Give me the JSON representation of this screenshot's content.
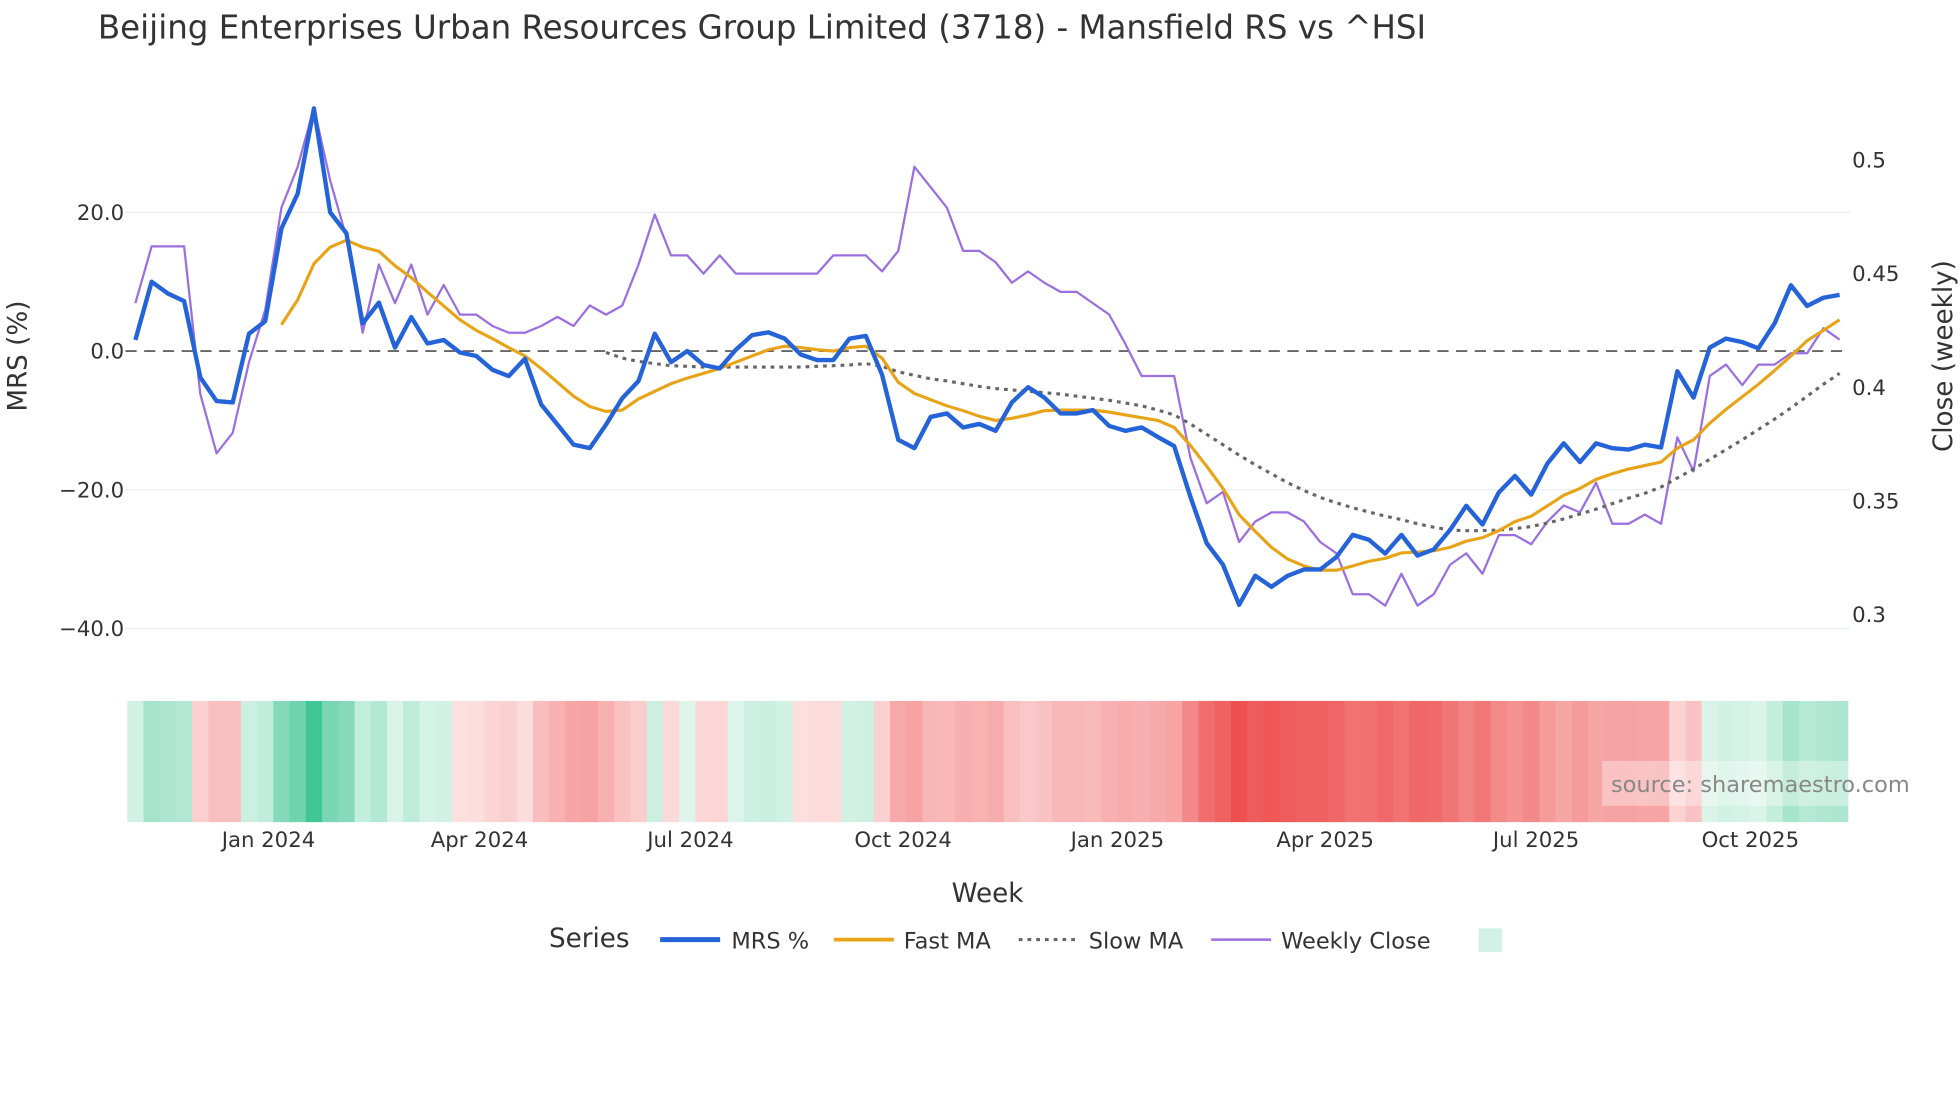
{
  "chart_data": {
    "type": "line",
    "title": "Beijing Enterprises Urban Resources Group Limited (3718) - Mansfield RS vs ^HSI",
    "xlabel": "Week",
    "ylabel": "MRS (%)",
    "y2label": "Close (weekly)",
    "ylim": [
      -50,
      40
    ],
    "y2lim": [
      0.26,
      0.535
    ],
    "yticks": [
      "20.0",
      "0.0",
      "−20.0",
      "−40.0"
    ],
    "ytick_values": [
      20,
      0,
      -20,
      -40
    ],
    "y2ticks": [
      "0.5",
      "0.45",
      "0.4",
      "0.35",
      "0.3"
    ],
    "y2tick_values": [
      0.5,
      0.45,
      0.4,
      0.35,
      0.3
    ],
    "xticks": [
      "Jan 2024",
      "Apr 2024",
      "Jul 2024",
      "Oct 2024",
      "Jan 2025",
      "Apr 2025",
      "Jul 2025",
      "Oct 2025"
    ],
    "xtick_week_index": [
      8.2,
      21.2,
      34.2,
      47.3,
      60.5,
      73.3,
      86.3,
      99.5
    ],
    "week_count": 106,
    "zero_line": 0,
    "grid": true,
    "legend_title": "Series",
    "legend_placement": "bottom-center",
    "source_label": "source: sharemaestro.com",
    "colors": {
      "mrs": "#2563d9",
      "fast": "#e8a317",
      "slow": "#666666",
      "close": "#9b6fe0",
      "heat_pos": "#3cc492",
      "heat_neg": "#ee4f4f"
    },
    "series": [
      {
        "name": "MRS %",
        "key": "mrs",
        "start": 0,
        "values": [
          1.6,
          10,
          8.3,
          7.2,
          -3.8,
          -7.2,
          -7.4,
          2.5,
          4.3,
          17.7,
          22.7,
          35,
          20,
          17,
          4,
          7,
          0.5,
          4.9,
          1.1,
          1.6,
          -0.2,
          -0.7,
          -2.7,
          -3.6,
          -1.1,
          -7.7,
          -10.6,
          -13.5,
          -14,
          -10.6,
          -6.8,
          -4.3,
          2.5,
          -1.6,
          0,
          -2,
          -2.5,
          0.2,
          2.3,
          2.7,
          1.8,
          -0.5,
          -1.3,
          -1.3,
          1.8,
          2.2,
          -3.4,
          -12.8,
          -14,
          -9.5,
          -9,
          -11,
          -10.5,
          -11.5,
          -7.4,
          -5.2,
          -6.7,
          -9,
          -9,
          -8.5,
          -10.8,
          -11.5,
          -11,
          -12.4,
          -13.7,
          -21,
          -27.7,
          -30.8,
          -36.6,
          -32.4,
          -34,
          -32.4,
          -31.5,
          -31.5,
          -29.7,
          -26.5,
          -27.2,
          -29.2,
          -26.5,
          -29.5,
          -28.6,
          -25.8,
          -22.3,
          -25,
          -20.4,
          -18,
          -20.7,
          -16.2,
          -13.3,
          -16,
          -13.3,
          -14,
          -14.2,
          -13.5,
          -13.9,
          -2.9,
          -6.7,
          0.5,
          1.8,
          1.3,
          0.4,
          4,
          9.5,
          6.5,
          7.7,
          8.1
        ]
      },
      {
        "name": "Fast MA",
        "key": "fast",
        "start": 9,
        "values": [
          3.8,
          7.4,
          12.6,
          15,
          16,
          15,
          14.4,
          12.3,
          10.6,
          8.5,
          6.5,
          4.5,
          3,
          1.8,
          0.5,
          -0.7,
          -2.5,
          -4.5,
          -6.5,
          -8,
          -8.7,
          -8.5,
          -6.9,
          -5.8,
          -4.7,
          -3.9,
          -3.2,
          -2.5,
          -1.6,
          -0.7,
          0.2,
          0.7,
          0.5,
          0.2,
          0,
          0.5,
          0.7,
          -1,
          -4.5,
          -6.1,
          -7,
          -7.9,
          -8.6,
          -9.4,
          -10,
          -9.7,
          -9.2,
          -8.6,
          -8.5,
          -8.5,
          -8.5,
          -8.8,
          -9.2,
          -9.6,
          -10,
          -11,
          -13.6,
          -16.6,
          -19.8,
          -23.6,
          -26,
          -28.3,
          -30,
          -31,
          -31.6,
          -31.6,
          -31,
          -30.3,
          -29.9,
          -29.1,
          -29,
          -28.8,
          -28.3,
          -27.4,
          -26.9,
          -25.9,
          -24.6,
          -23.8,
          -22.3,
          -20.8,
          -19.8,
          -18.5,
          -17.7,
          -17,
          -16.5,
          -16,
          -14,
          -12.8,
          -10.4,
          -8.4,
          -6.6,
          -4.8,
          -2.8,
          -0.7,
          1.5,
          3,
          4.5
        ]
      },
      {
        "name": "Slow MA",
        "key": "slow",
        "start": 29,
        "values": [
          -0.2,
          -1,
          -1.5,
          -1.8,
          -2.1,
          -2.2,
          -2.3,
          -2.3,
          -2.3,
          -2.3,
          -2.3,
          -2.3,
          -2.3,
          -2.2,
          -2.1,
          -2,
          -1.8,
          -2.2,
          -3,
          -3.5,
          -4,
          -4.3,
          -4.7,
          -5.1,
          -5.4,
          -5.6,
          -5.8,
          -6,
          -6.2,
          -6.5,
          -6.8,
          -7.1,
          -7.5,
          -7.9,
          -8.5,
          -9.2,
          -10.5,
          -12,
          -13.5,
          -15,
          -16.4,
          -17.7,
          -19,
          -20.1,
          -21.1,
          -21.9,
          -22.6,
          -23.2,
          -23.8,
          -24.3,
          -24.9,
          -25.4,
          -25.8,
          -25.9,
          -25.9,
          -25.8,
          -25.6,
          -25.3,
          -24.8,
          -24.2,
          -23.5,
          -22.8,
          -22,
          -21.2,
          -20.5,
          -19.6,
          -18.3,
          -17,
          -15.6,
          -14.2,
          -12.8,
          -11.3,
          -9.8,
          -8.2,
          -6.5,
          -4.8,
          -3.2
        ]
      },
      {
        "name": "Weekly Close",
        "key": "close",
        "axis": "y2",
        "start": 0,
        "values": [
          0.437,
          0.462,
          0.462,
          0.462,
          0.397,
          0.371,
          0.38,
          0.411,
          0.434,
          0.479,
          0.497,
          0.523,
          0.491,
          0.466,
          0.424,
          0.454,
          0.437,
          0.454,
          0.432,
          0.445,
          0.432,
          0.432,
          0.427,
          0.424,
          0.424,
          0.427,
          0.431,
          0.427,
          0.436,
          0.432,
          0.436,
          0.454,
          0.476,
          0.458,
          0.458,
          0.45,
          0.458,
          0.45,
          0.45,
          0.45,
          0.45,
          0.45,
          0.45,
          0.458,
          0.458,
          0.458,
          0.451,
          0.46,
          0.497,
          0.488,
          0.479,
          0.46,
          0.46,
          0.455,
          0.446,
          0.451,
          0.446,
          0.442,
          0.442,
          0.437,
          0.432,
          0.419,
          0.405,
          0.405,
          0.405,
          0.369,
          0.349,
          0.354,
          0.332,
          0.341,
          0.345,
          0.345,
          0.341,
          0.332,
          0.327,
          0.309,
          0.309,
          0.304,
          0.318,
          0.304,
          0.309,
          0.322,
          0.327,
          0.318,
          0.335,
          0.335,
          0.331,
          0.341,
          0.348,
          0.345,
          0.358,
          0.34,
          0.34,
          0.344,
          0.34,
          0.378,
          0.363,
          0.405,
          0.41,
          0.401,
          0.41,
          0.41,
          0.415,
          0.415,
          0.426,
          0.421
        ]
      }
    ]
  }
}
